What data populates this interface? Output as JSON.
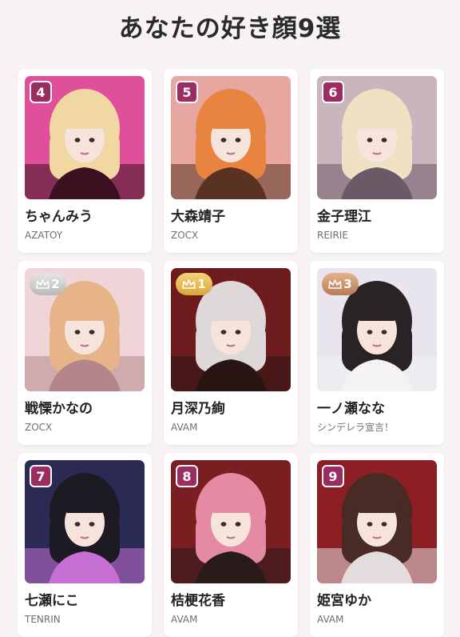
{
  "page": {
    "title": "あなたの好き顔9選"
  },
  "cards": [
    {
      "rank": "4",
      "name": "ちゃんみう",
      "group": "AZATOY",
      "badge_type": "number",
      "palette": [
        "#e04f9a",
        "#f1d7a2",
        "#3b1020"
      ]
    },
    {
      "rank": "5",
      "name": "大森靖子",
      "group": "ZOCX",
      "badge_type": "number",
      "palette": [
        "#e7a7a0",
        "#e8843f",
        "#5a3222"
      ]
    },
    {
      "rank": "6",
      "name": "金子理江",
      "group": "REIRIE",
      "badge_type": "number",
      "palette": [
        "#c9b5bd",
        "#efe1c4",
        "#6b5a66"
      ]
    },
    {
      "rank": "2",
      "name": "戦慄かなの",
      "group": "ZOCX",
      "badge_type": "silver",
      "palette": [
        "#efd4d8",
        "#e6b486",
        "#b4868c"
      ]
    },
    {
      "rank": "1",
      "name": "月深乃絢",
      "group": "AVAM",
      "badge_type": "gold",
      "palette": [
        "#6e1b1e",
        "#dfd8d8",
        "#2a1515"
      ]
    },
    {
      "rank": "3",
      "name": "一ノ瀬なな",
      "group": "シンデレラ宣言！",
      "badge_type": "bronze",
      "palette": [
        "#e9e5ee",
        "#2a2326",
        "#f4f2f4"
      ]
    },
    {
      "rank": "7",
      "name": "七瀬にこ",
      "group": "TENRIN",
      "badge_type": "number",
      "palette": [
        "#2b2a55",
        "#1d1a24",
        "#c86fd6"
      ]
    },
    {
      "rank": "8",
      "name": "桔梗花香",
      "group": "AVAM",
      "badge_type": "number",
      "palette": [
        "#7a1e22",
        "#e58aa3",
        "#2a1b1b"
      ]
    },
    {
      "rank": "9",
      "name": "姫宮ゆか",
      "group": "AVAM",
      "badge_type": "number",
      "palette": [
        "#8d1f24",
        "#4a2a24",
        "#e2dcdc"
      ]
    }
  ]
}
